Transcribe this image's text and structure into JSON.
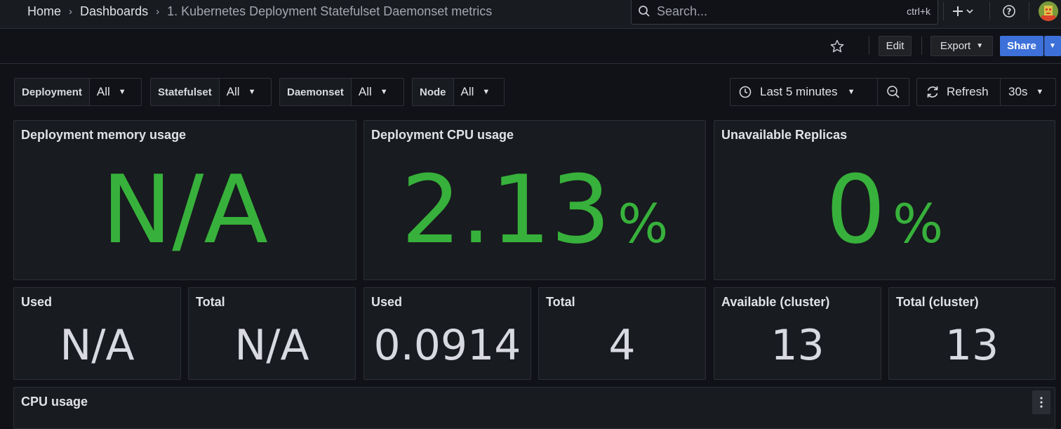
{
  "breadcrumb": {
    "home": "Home",
    "dashboards": "Dashboards",
    "current": "1. Kubernetes Deployment Statefulset Daemonset metrics"
  },
  "search": {
    "placeholder": "Search...",
    "shortcut": "ctrl+k"
  },
  "toolbar": {
    "edit_label": "Edit",
    "export_label": "Export",
    "share_label": "Share"
  },
  "variables": [
    {
      "label": "Deployment",
      "value": "All"
    },
    {
      "label": "Statefulset",
      "value": "All"
    },
    {
      "label": "Daemonset",
      "value": "All"
    },
    {
      "label": "Node",
      "value": "All"
    }
  ],
  "time_range": {
    "label": "Last 5 minutes"
  },
  "refresh": {
    "label": "Refresh",
    "interval": "30s"
  },
  "panels": {
    "deploy_mem": {
      "title": "Deployment memory usage",
      "value": "N/A",
      "unit": ""
    },
    "deploy_cpu": {
      "title": "Deployment CPU usage",
      "value": "2.13",
      "unit": "%"
    },
    "unavail": {
      "title": "Unavailable Replicas",
      "value": "0",
      "unit": "%"
    },
    "mem_used": {
      "title": "Used",
      "value": "N/A"
    },
    "mem_total": {
      "title": "Total",
      "value": "N/A"
    },
    "cpu_used": {
      "title": "Used",
      "value": "0.0914"
    },
    "cpu_total": {
      "title": "Total",
      "value": "4"
    },
    "avail_cluster": {
      "title": "Available (cluster)",
      "value": "13"
    },
    "total_cluster": {
      "title": "Total (cluster)",
      "value": "13"
    },
    "cpu_usage": {
      "title": "CPU usage"
    }
  },
  "colors": {
    "accent": "#3d71d9",
    "value_green": "#37b13b",
    "background": "#111217",
    "panel": "#181b1f"
  },
  "icons": [
    "search-icon",
    "plus-icon",
    "help-icon",
    "star-icon",
    "clock-icon",
    "zoom-out-icon",
    "refresh-icon",
    "kebab-menu-icon"
  ]
}
